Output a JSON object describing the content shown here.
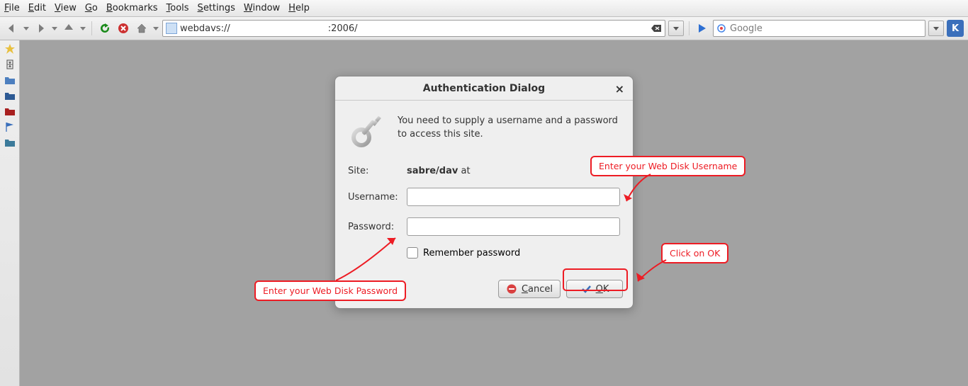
{
  "menubar": {
    "items": [
      "File",
      "Edit",
      "View",
      "Go",
      "Bookmarks",
      "Tools",
      "Settings",
      "Window",
      "Help"
    ]
  },
  "toolbar": {
    "address_prefix": "webdavs://",
    "address_suffix": ":2006/",
    "search_placeholder": "Google"
  },
  "dialog": {
    "title": "Authentication Dialog",
    "message": "You need to supply a username and a password to access this site.",
    "site_label": "Site:",
    "site_value_bold": "sabre/dav",
    "site_value_rest": " at ",
    "username_label": "Username:",
    "username_value": "",
    "password_label": "Password:",
    "password_value": "",
    "remember_label": "Remember password",
    "cancel_label": "Cancel",
    "ok_label": "OK"
  },
  "annotations": {
    "username_hint": "Enter your Web Disk Username",
    "password_hint": "Enter your Web Disk Password",
    "ok_hint": "Click on OK"
  }
}
